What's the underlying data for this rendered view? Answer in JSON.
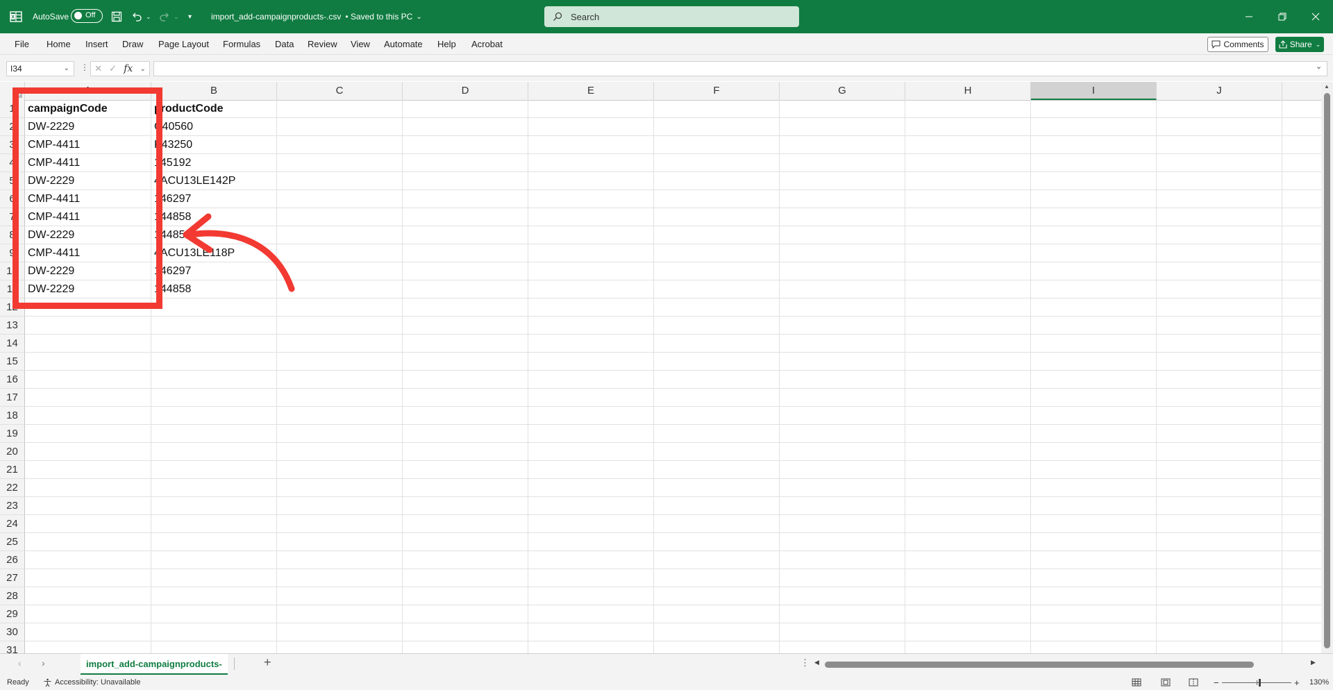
{
  "titlebar": {
    "autosave_label": "AutoSave",
    "autosave_state": "Off",
    "filename": "import_add-campaignproducts-.csv",
    "save_status": "• Saved to this PC",
    "search_placeholder": "Search",
    "accent_color": "#107c41"
  },
  "menu": {
    "items": [
      "File",
      "Home",
      "Insert",
      "Draw",
      "Page Layout",
      "Formulas",
      "Data",
      "Review",
      "View",
      "Automate",
      "Help",
      "Acrobat"
    ],
    "comments_label": "Comments",
    "share_label": "Share"
  },
  "formula_bar": {
    "name_box": "I34",
    "fx_label": "fx",
    "formula": ""
  },
  "grid": {
    "columns": [
      "A",
      "B",
      "C",
      "D",
      "E",
      "F",
      "G",
      "H",
      "I",
      "J"
    ],
    "selected_column": "I",
    "rows": [
      "1",
      "2",
      "3",
      "4",
      "5",
      "6",
      "7",
      "8",
      "9",
      "10",
      "11",
      "12",
      "13",
      "14",
      "15",
      "16",
      "17",
      "18",
      "19",
      "20",
      "21",
      "22",
      "23",
      "24",
      "25",
      "26",
      "27",
      "28",
      "29",
      "30",
      "31"
    ],
    "headers": [
      "campaignCode",
      "productCode"
    ],
    "data": [
      [
        "DW-2229",
        "C40560"
      ],
      [
        "CMP-4411",
        "K43250"
      ],
      [
        "CMP-4411",
        "145192"
      ],
      [
        "DW-2229",
        "4ACU13LE142P"
      ],
      [
        "CMP-4411",
        "146297"
      ],
      [
        "CMP-4411",
        "144858"
      ],
      [
        "DW-2229",
        "144858"
      ],
      [
        "CMP-4411",
        "4ACU13LE118P"
      ],
      [
        "DW-2229",
        "146297"
      ],
      [
        "DW-2229",
        "144858"
      ]
    ]
  },
  "annotation": {
    "color": "#f23a32"
  },
  "sheet": {
    "tab_name": "import_add-campaignproducts-",
    "add_sheet_symbol": "+"
  },
  "status": {
    "ready": "Ready",
    "accessibility": "Accessibility: Unavailable",
    "zoom": "130%"
  }
}
